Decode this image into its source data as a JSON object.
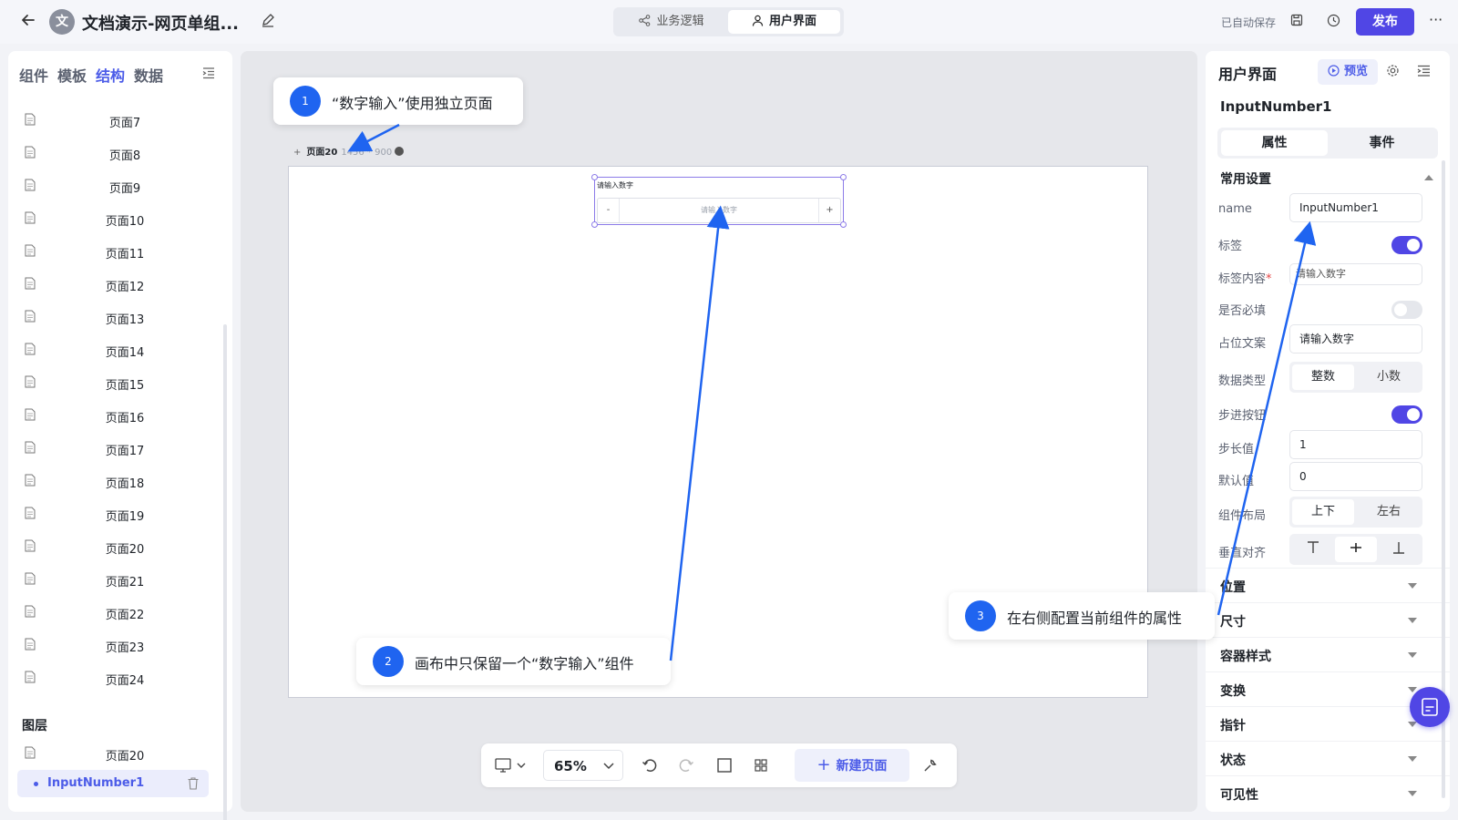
{
  "topbar": {
    "avatar_char": "文",
    "app_title": "文档演示-网页单组...",
    "modes": [
      "业务逻辑",
      "用户界面"
    ],
    "active_mode": "用户界面",
    "autosave": "已自动保存",
    "publish_label": "发布",
    "more": "···"
  },
  "left_panel": {
    "tabs": [
      "组件",
      "模板",
      "结构",
      "数据"
    ],
    "active_tab": "结构",
    "pages": [
      "页面7",
      "页面8",
      "页面9",
      "页面10",
      "页面11",
      "页面12",
      "页面13",
      "页面14",
      "页面15",
      "页面16",
      "页面17",
      "页面18",
      "页面19",
      "页面20",
      "页面21",
      "页面22",
      "页面23",
      "页面24"
    ],
    "layers_title": "图层",
    "layer_page": "页面20",
    "layer_component": "InputNumber1"
  },
  "canvas": {
    "frame_name": "页面20",
    "frame_dims": "1456 * 900",
    "component": {
      "label": "请输入数字",
      "placeholder": "请输入数字",
      "minus": "-",
      "plus": "+"
    }
  },
  "bottom_toolbar": {
    "zoom": "65%",
    "new_page_label": "新建页面"
  },
  "right_panel": {
    "title": "用户界面",
    "preview_label": "预览",
    "component_name": "InputNumber1",
    "tabs": [
      "属性",
      "事件"
    ],
    "active_tab": "属性",
    "section_common": "常用设置",
    "props": {
      "name_label": "name",
      "name_value": "InputNumber1",
      "tag_label": "标签",
      "tag_on": true,
      "tag_content_label": "标签内容",
      "tag_content_value": "请输入数字",
      "required_label": "是否必填",
      "required_on": false,
      "placeholder_label": "占位文案",
      "placeholder_value": "请输入数字",
      "datatype_label": "数据类型",
      "datatype_options": [
        "整数",
        "小数"
      ],
      "datatype_selected": "整数",
      "step_btn_label": "步进按钮",
      "step_btn_on": true,
      "step_label": "步长值",
      "step_value": "1",
      "default_label": "默认值",
      "default_value": "0",
      "layout_label": "组件布局",
      "layout_options": [
        "上下",
        "左右"
      ],
      "layout_selected": "上下",
      "valign_label": "垂直对齐"
    },
    "sections": [
      "位置",
      "尺寸",
      "容器样式",
      "变换",
      "指针",
      "状态",
      "可见性"
    ]
  },
  "annotations": [
    {
      "num": "1",
      "text": "“数字输入”使用独立页面"
    },
    {
      "num": "2",
      "text": "画布中只保留一个“数字输入”组件"
    },
    {
      "num": "3",
      "text": "在右侧配置当前组件的属性"
    }
  ],
  "colors": {
    "accent": "#5046e5",
    "annotation_blue": "#1f64f0"
  }
}
